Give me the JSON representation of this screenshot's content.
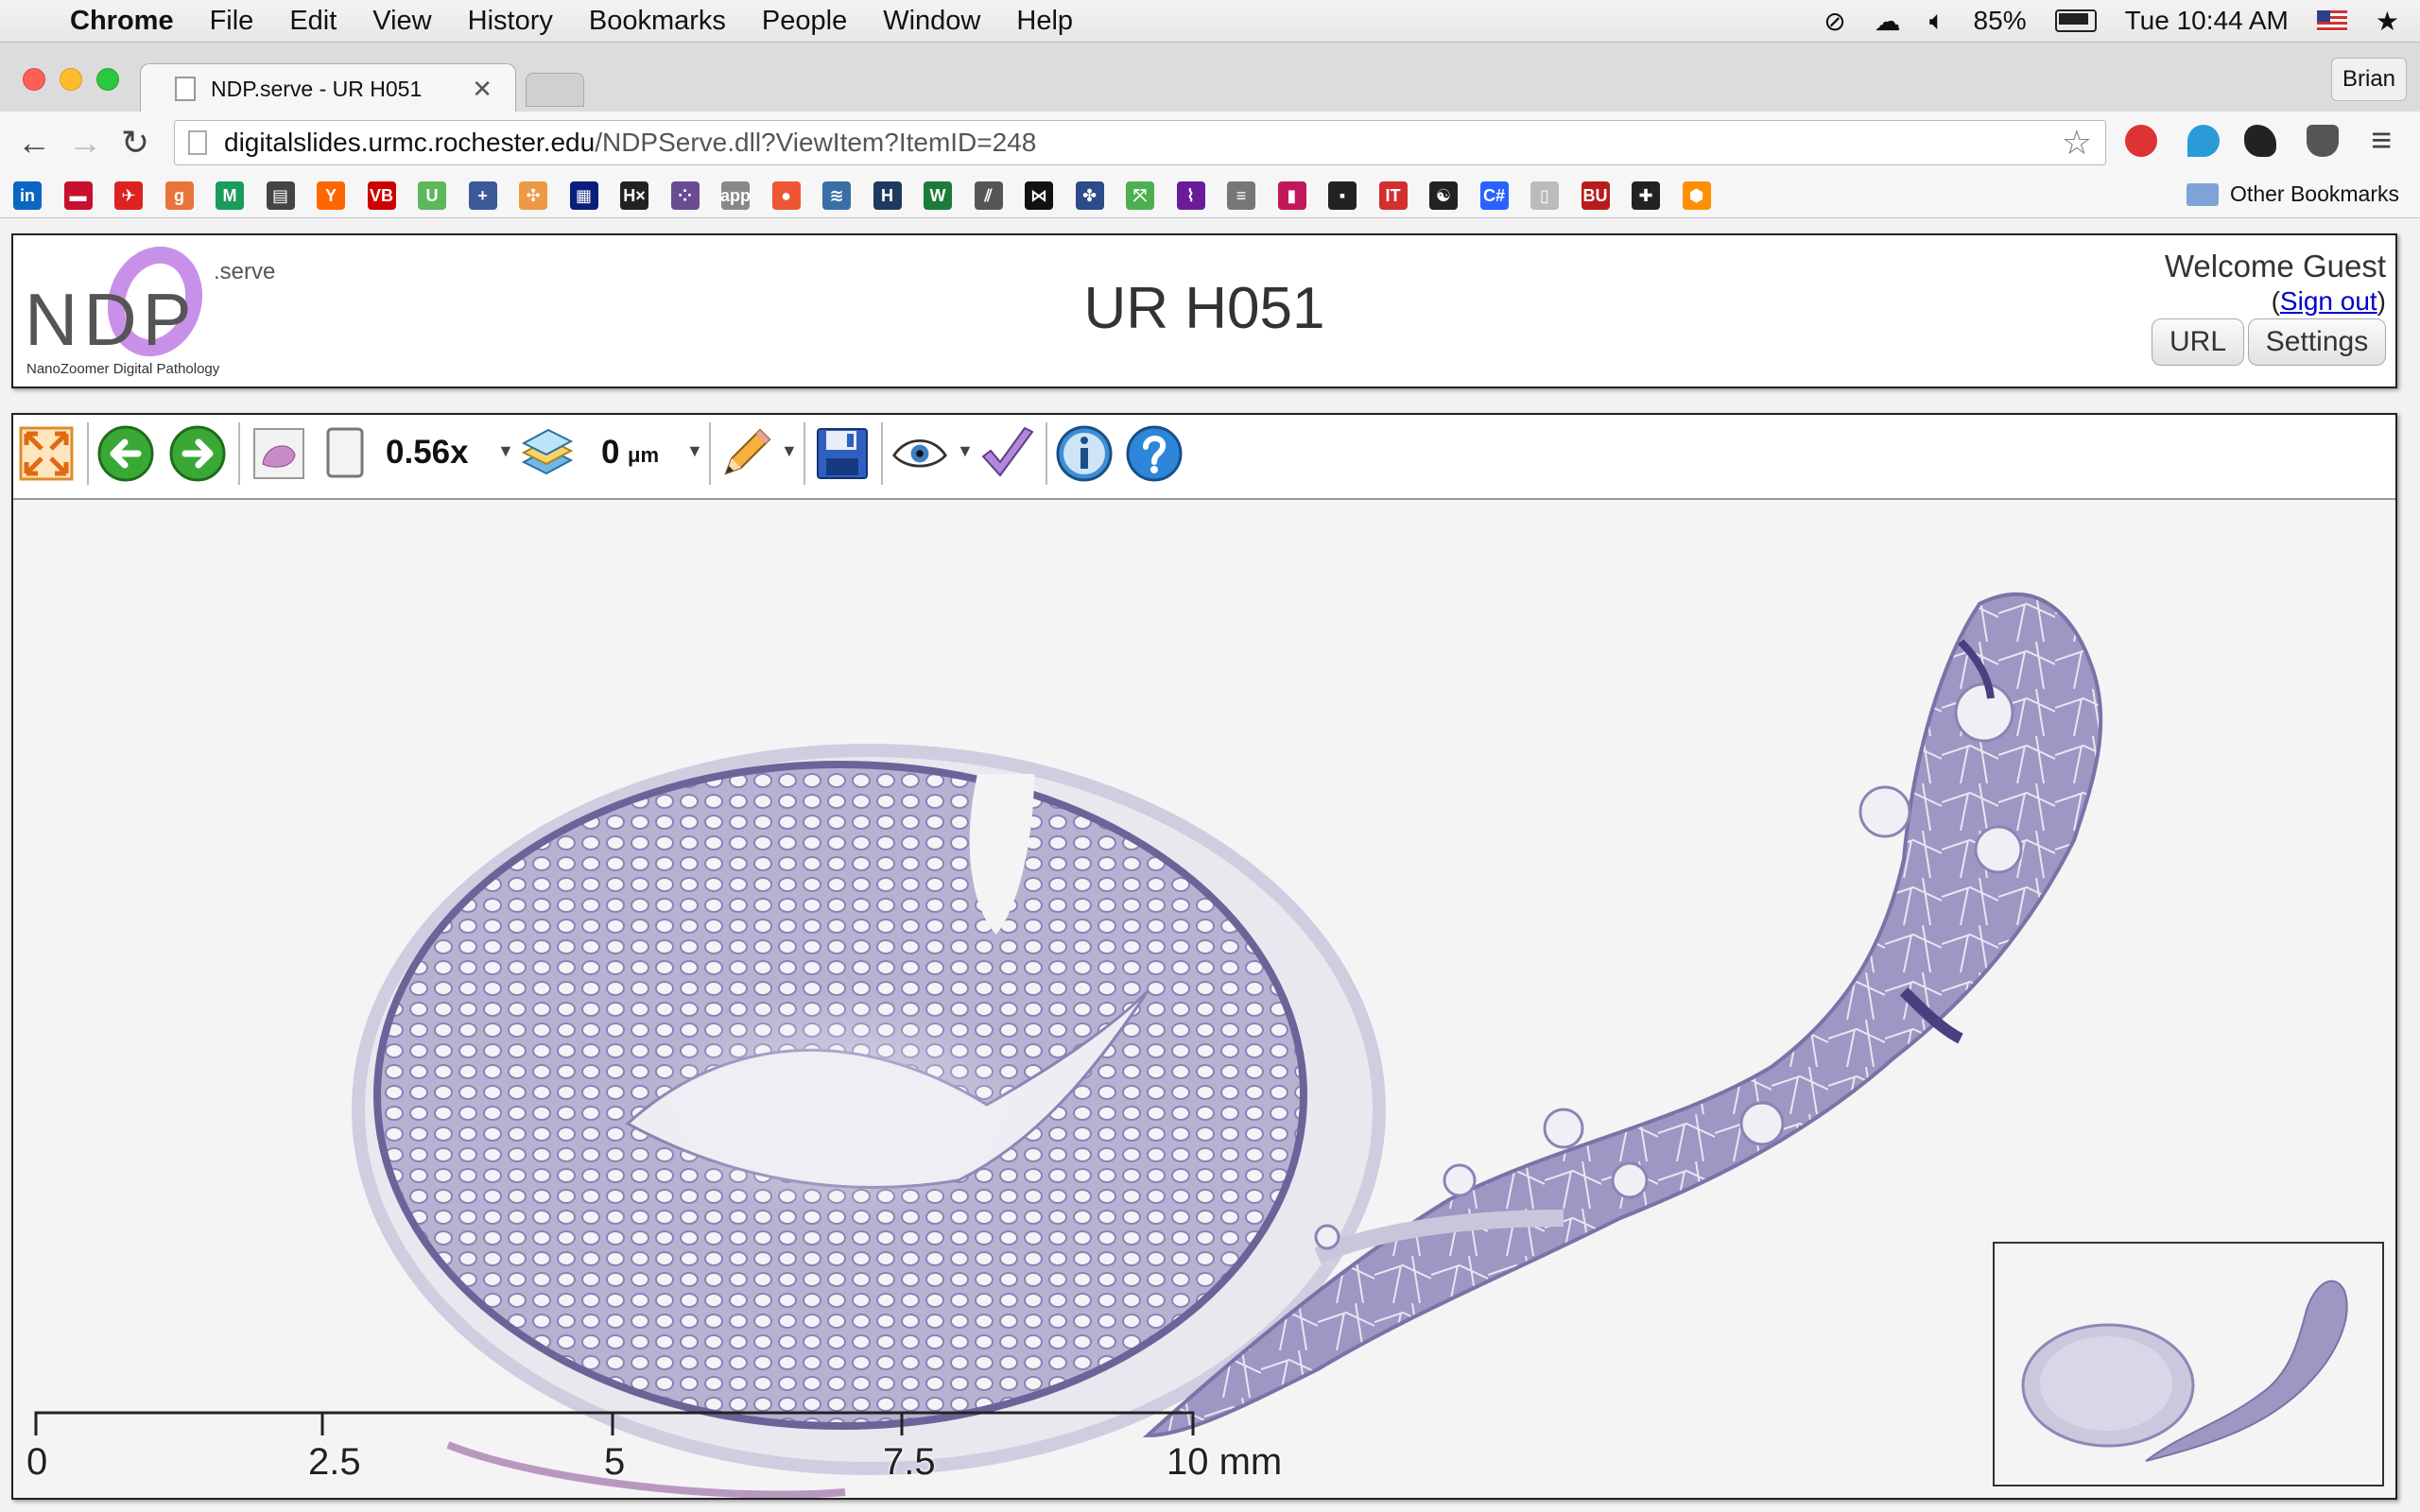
{
  "menubar": {
    "app_name": "Chrome",
    "items": [
      "File",
      "Edit",
      "View",
      "History",
      "Bookmarks",
      "People",
      "Window",
      "Help"
    ],
    "battery": "85%",
    "clock": "Tue 10:44 AM"
  },
  "browser": {
    "tab_title": "NDP.serve - UR H051",
    "profile": "Brian",
    "url_host": "digitalslides.urmc.rochester.edu",
    "url_path": "/NDPServe.dll?ViewItem?ItemID=248",
    "other_bookmarks": "Other Bookmarks",
    "bookmark_icons": [
      "in",
      "▬",
      "✈",
      "g",
      "M",
      "▤",
      "Y",
      "VB",
      "U",
      "+",
      "✣",
      "▦",
      "H×",
      "⁘",
      "app",
      "●",
      "≋",
      "H",
      "W",
      "⫽",
      "⋈",
      "✤",
      "⤧",
      "⌇",
      "≡",
      "▮",
      "▪",
      "IT",
      "☯",
      "C#",
      "▯",
      "BU",
      "✚",
      "⬢"
    ]
  },
  "app": {
    "logo_main": "NDP",
    "logo_serve": ".serve",
    "logo_sub": "NanoZoomer Digital Pathology",
    "slide_title": "UR H051",
    "welcome": "Welcome Guest",
    "sign_out": "Sign out",
    "url_button": "URL",
    "settings_button": "Settings"
  },
  "viewer": {
    "zoom": "0.56x",
    "z_offset": "0",
    "z_unit": "μm",
    "scale_labels": [
      "0",
      "2.5",
      "5",
      "7.5",
      "10 mm"
    ],
    "colors": {
      "stain": "#8e86b6",
      "stain_dark": "#5c4f8a",
      "background": "#f4f4f5"
    }
  }
}
